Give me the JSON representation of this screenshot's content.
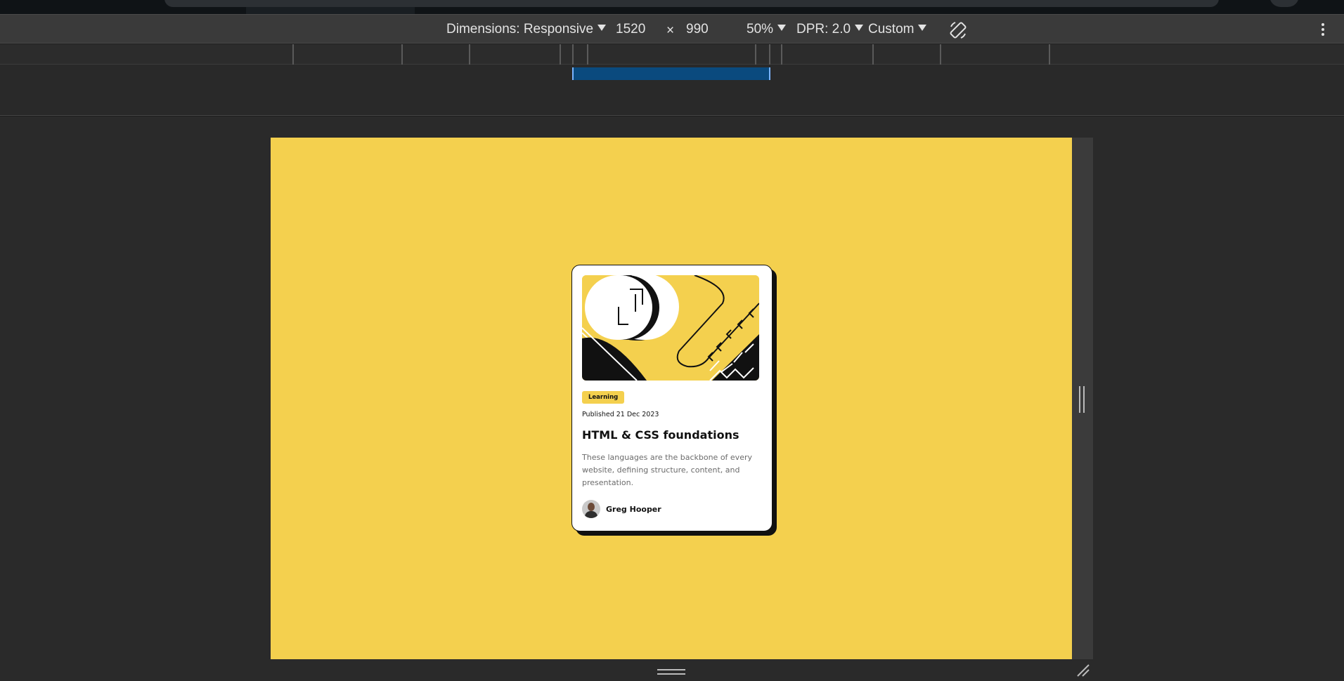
{
  "toolbar": {
    "dimensions_label": "Dimensions: Responsive",
    "width_value": "1520",
    "times_symbol": "×",
    "height_value": "990",
    "zoom": "50%",
    "dpr": "DPR: 2.0",
    "throttling": "Custom"
  },
  "card": {
    "tag": "Learning",
    "published": "Published 21 Dec 2023",
    "title": "HTML & CSS foundations",
    "description": "These languages are the backbone of every website, defining structure, content, and presentation.",
    "author": "Greg Hooper"
  },
  "colors": {
    "page_background": "#f4d04e",
    "card_background": "#ffffff",
    "ink": "#111111",
    "devtools_toolbar": "#3a3a3a"
  },
  "icons": [
    "caret-down-icon",
    "rotate-icon",
    "more-options-icon",
    "resize-corner-icon"
  ]
}
